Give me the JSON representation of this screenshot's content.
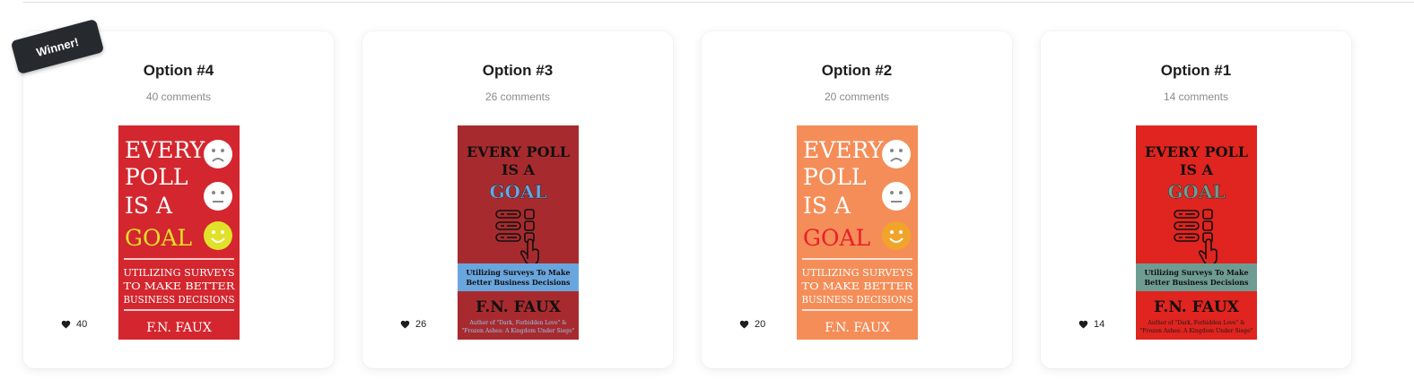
{
  "badge": {
    "winner_label": "Winner!"
  },
  "options": [
    {
      "title": "Option #4",
      "comments": "40 comments",
      "likes": "40",
      "cover": {
        "style": "modern",
        "bg": "#d4262e",
        "title_lines": [
          "EVERY",
          "POLL",
          "IS A",
          "GOAL"
        ],
        "goal_color": "#e1e12a",
        "smile_color": "#e1e12a",
        "subtitle_lines": [
          "UTILIZING SURVEYS",
          "TO MAKE BETTER",
          "BUSINESS DECISIONS"
        ],
        "author": "F.N. FAUX"
      }
    },
    {
      "title": "Option #3",
      "comments": "26 comments",
      "likes": "26",
      "cover": {
        "style": "classic",
        "bg": "#a72b2e",
        "band_color": "#6aa6de",
        "title_lines": [
          "EVERY POLL",
          "IS A"
        ],
        "goal_word": "GOAL",
        "goal_color": "#6aa6de",
        "band_lines": [
          "Utilizing Surveys To Make",
          "Better Business Decisions"
        ],
        "author": "F.N. FAUX",
        "author_note_lines": [
          "Author of \"Dark, Forbidden Love\" &",
          "\"Frozen Ashes: A Kingdom Under Siege\""
        ],
        "note_color": "#9cc4ee"
      }
    },
    {
      "title": "Option #2",
      "comments": "20 comments",
      "likes": "20",
      "cover": {
        "style": "modern",
        "bg": "#f58d58",
        "title_lines": [
          "EVERY",
          "POLL",
          "IS A",
          "GOAL"
        ],
        "goal_color": "#e8202a",
        "smile_color": "#f0a52a",
        "subtitle_lines": [
          "UTILIZING SURVEYS",
          "TO MAKE BETTER",
          "BUSINESS DECISIONS"
        ],
        "author": "F.N. FAUX"
      }
    },
    {
      "title": "Option #1",
      "comments": "14 comments",
      "likes": "14",
      "cover": {
        "style": "classic",
        "bg": "#e0241f",
        "band_color": "#6f9c92",
        "title_lines": [
          "EVERY POLL",
          "IS A"
        ],
        "goal_word": "GOAL",
        "goal_color": "#6f9c92",
        "band_lines": [
          "Utilizing Surveys To Make",
          "Better Business Decisions"
        ],
        "author": "F.N. FAUX",
        "author_note_lines": [
          "Author of \"Dark, Forbidden Love\" &",
          "\"Frozen Ashes: A Kingdom Under Siege\""
        ],
        "note_color": "#1a1a1a"
      }
    }
  ]
}
